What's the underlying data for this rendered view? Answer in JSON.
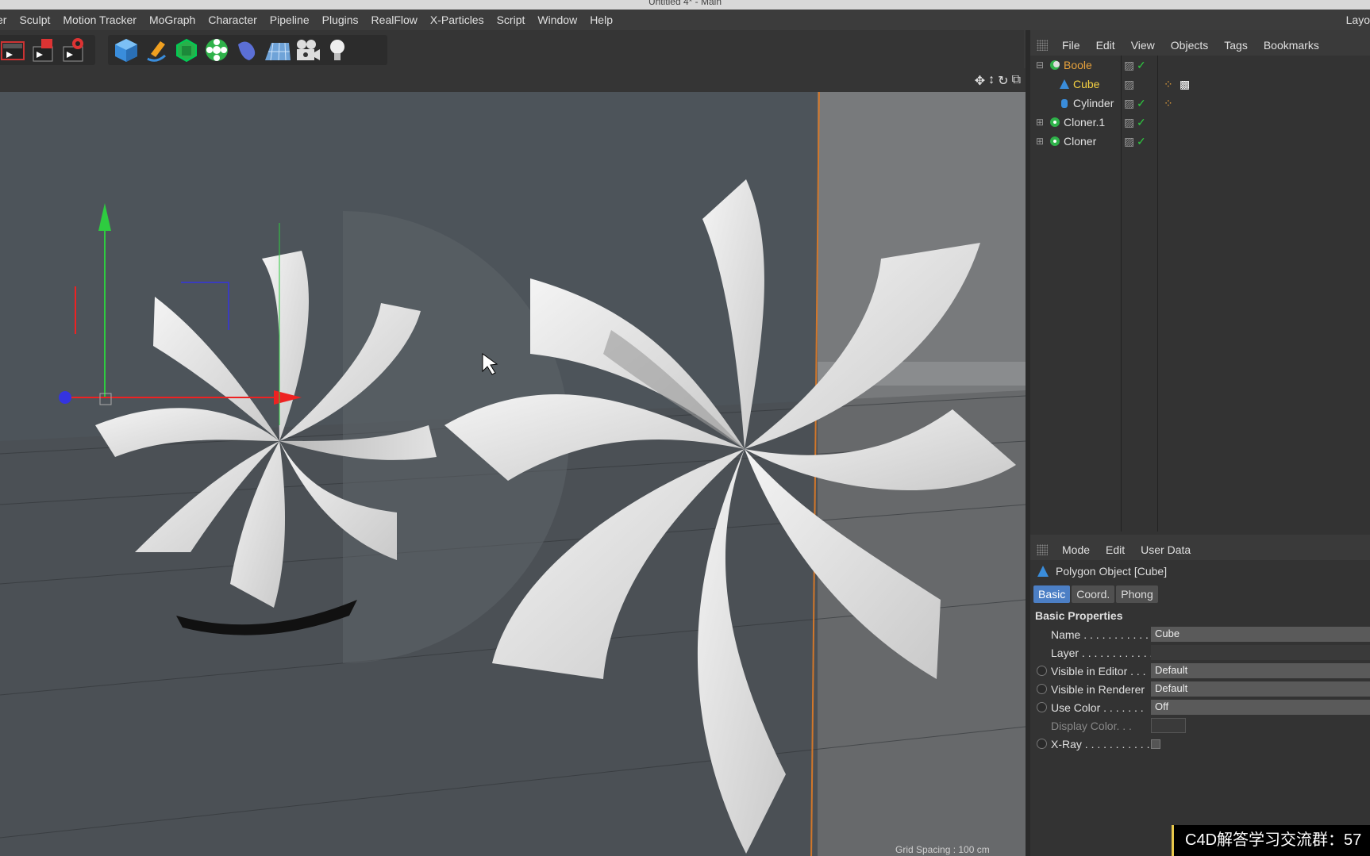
{
  "window": {
    "title": "Untitled 4* - Main"
  },
  "menubar": {
    "items": [
      "er",
      "Sculpt",
      "Motion Tracker",
      "MoGraph",
      "Character",
      "Pipeline",
      "Plugins",
      "RealFlow",
      "X-Particles",
      "Script",
      "Window",
      "Help"
    ],
    "layout": "Layo"
  },
  "toolbar": {
    "icons": [
      "render-view-icon",
      "render-picture-viewer-icon",
      "render-settings-icon",
      "cube-icon",
      "pen-icon",
      "subdivision-icon",
      "cloner-icon",
      "deformer-icon",
      "floor-icon",
      "camera-icon",
      "light-icon"
    ]
  },
  "object_manager": {
    "menu": [
      "File",
      "Edit",
      "View",
      "Objects",
      "Tags",
      "Bookmarks"
    ],
    "objects": [
      {
        "name": "Boole",
        "color": "#e8a23c",
        "icon": "boole-icon"
      },
      {
        "name": "Cube",
        "color": "#f5d142",
        "icon": "polygon-icon"
      },
      {
        "name": "Cylinder",
        "color": "#e0e0e0",
        "icon": "cylinder-icon"
      },
      {
        "name": "Cloner.1",
        "color": "#e0e0e0",
        "icon": "cloner-icon"
      },
      {
        "name": "Cloner",
        "color": "#e0e0e0",
        "icon": "cloner-icon"
      }
    ]
  },
  "attribute_manager": {
    "menu": [
      "Mode",
      "Edit",
      "User Data"
    ],
    "object_title": "Polygon Object [Cube]",
    "tabs": [
      "Basic",
      "Coord.",
      "Phong"
    ],
    "section": "Basic Properties",
    "properties": [
      {
        "label": "Name . . . . . . . . . . . .",
        "value": "Cube"
      },
      {
        "label": "Layer . . . . . . . . . . . .",
        "value": ""
      },
      {
        "label": "Visible in Editor . . .",
        "value": "Default"
      },
      {
        "label": "Visible in Renderer",
        "value": "Default"
      },
      {
        "label": "Use Color . . . . . . .",
        "value": "Off"
      },
      {
        "label": "Display Color. . .",
        "value": ""
      },
      {
        "label": "X-Ray . . . . . . . . . . .",
        "value": ""
      }
    ]
  },
  "viewport": {
    "grid_spacing": "Grid Spacing : 100 cm",
    "background_color": "#4d545a"
  },
  "watermark": {
    "text": "C4D解答学习交流群：57"
  }
}
